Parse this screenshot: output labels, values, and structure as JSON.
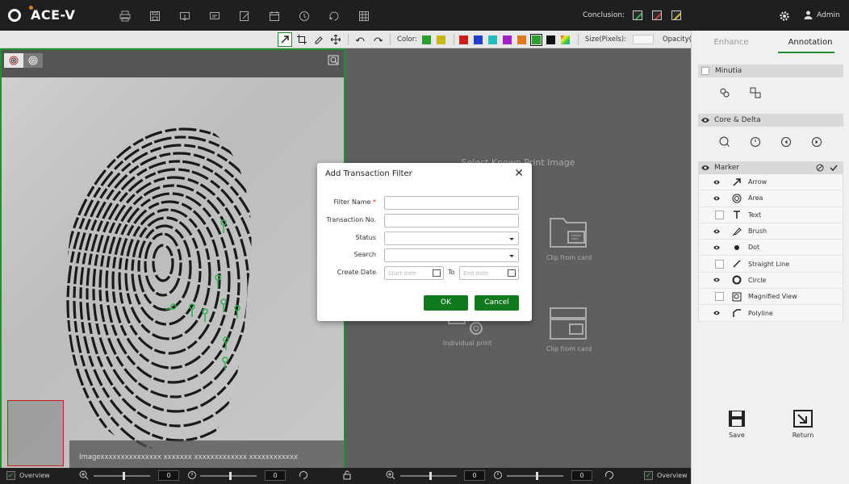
{
  "app": {
    "title": "ACE-V"
  },
  "header": {
    "tools": [
      "print-icon",
      "save-icon",
      "import-icon",
      "export-icon",
      "edit-icon",
      "calendar-icon",
      "history-icon",
      "rotate-icon",
      "grid-icon"
    ],
    "conclusion_label": "Conclusion:",
    "conclusion_colors": [
      "#2bb34a",
      "#e23a3a",
      "#e0c020"
    ],
    "user": "Admin"
  },
  "toolbar": {
    "color_label": "Color:",
    "colors": [
      "#2aa12f",
      "#c7b800",
      "#d21b1b",
      "#1e3fd0",
      "#20c0c0",
      "#a020c8",
      "#e07b1a",
      "#2aa12f",
      "#111111"
    ],
    "size_label": "Size(Pixels):",
    "opacity_label": "Opacity(%):"
  },
  "left_pane": {
    "caption": "Imagexxxxxxxxxxxxxxx xxxxxxx xxxxxxxxxxxxx xxxxxxxxxxxx"
  },
  "right_pane": {
    "title": "Select Known Print Image",
    "cards": [
      {
        "label": "Clip from card"
      },
      {
        "label": "Individual print"
      },
      {
        "label": "Clip from card"
      }
    ]
  },
  "bottom_bar": {
    "overview_left": "Overview",
    "overview_right": "Overview",
    "values": [
      "0",
      "0",
      "0",
      "0"
    ]
  },
  "sidebar": {
    "tabs": [
      "Enhance",
      "Annotation"
    ],
    "minutia": "Minutia",
    "core_delta": "Core & Delta",
    "marker": "Marker",
    "markers": [
      {
        "label": "Arrow",
        "visible": true
      },
      {
        "label": "Area",
        "visible": true
      },
      {
        "label": "Text",
        "visible": false
      },
      {
        "label": "Brush",
        "visible": true
      },
      {
        "label": "Dot",
        "visible": true
      },
      {
        "label": "Straight Line",
        "visible": false
      },
      {
        "label": "Circle",
        "visible": true
      },
      {
        "label": "Magnified View",
        "visible": false
      },
      {
        "label": "Polyline",
        "visible": true
      }
    ],
    "save": "Save",
    "return": "Return"
  },
  "dialog": {
    "title": "Add Transaction Filter",
    "fields": {
      "filter_name": "Filter Name",
      "transaction_no": "Transaction No.",
      "status": "Status",
      "search": "Search",
      "create_date": "Create Date",
      "start_placeholder": "Start date",
      "to": "To",
      "end_placeholder": "End date"
    },
    "ok": "OK",
    "cancel": "Cancel"
  }
}
